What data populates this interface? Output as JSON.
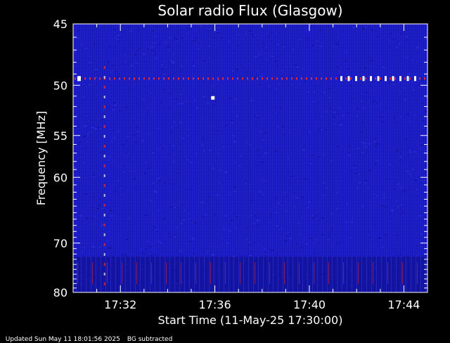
{
  "chart_data": {
    "type": "heatmap",
    "title": "Solar radio Flux (Glasgow)",
    "xlabel": "Start Time (11-May-25 17:30:00)",
    "ylabel": "Frequency [MHz]",
    "x_ticks": [
      "17:32",
      "17:36",
      "17:40",
      "17:44"
    ],
    "x_tick_minutes": [
      2,
      6,
      10,
      14
    ],
    "xlim_minutes": [
      0,
      15
    ],
    "y_ticks": [
      45,
      50,
      55,
      60,
      70,
      80
    ],
    "ylim": [
      45,
      80
    ],
    "y_scale": "reciprocal",
    "colors": {
      "background": "#000000",
      "field": "#1c1cc4",
      "field_dark": "#0c0c86",
      "field_light": "#3a3ae0",
      "interference": "#ff3020",
      "hot": "#ffffff"
    },
    "features": {
      "rfi_line_mhz": 49.4,
      "bright_spot": {
        "time_min": 5.9,
        "freq_mhz": 51.2
      },
      "vertical_streak_min": 1.3,
      "lower_band_mhz": [
        72.5,
        80
      ]
    }
  },
  "footer": {
    "updated": "Updated Sun May 11 18:01:56 2025",
    "note": "BG subtracted"
  }
}
